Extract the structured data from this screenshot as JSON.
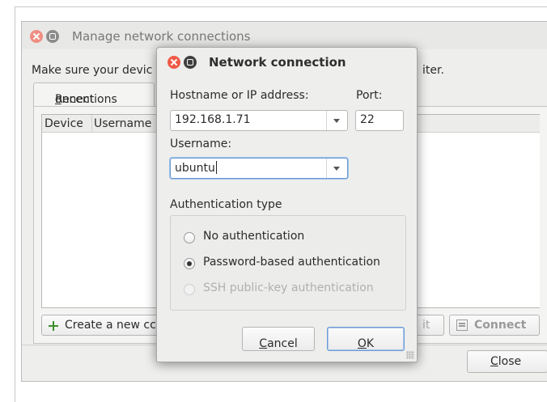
{
  "background_window": {
    "title": "Manage network connections",
    "instruction_start": "Make sure your devic",
    "instruction_end": "iter.",
    "tab": {
      "prefix": "Recent ",
      "accel": "c",
      "suffix": "onnections"
    },
    "columns": [
      "Device",
      "Username"
    ],
    "buttons": {
      "create": "Create a new cc",
      "edit": "it",
      "connect": "Connect",
      "close_accel": "C",
      "close_rest": "lose"
    }
  },
  "dialog": {
    "title": "Network connection",
    "hostname_label": "Hostname or IP address:",
    "hostname_value": "192.168.1.71",
    "port_label": "Port:",
    "port_value": "22",
    "username_label": "Username:",
    "username_value": "ubuntu",
    "auth_label": "Authentication type",
    "auth_options": [
      {
        "label": "No authentication",
        "checked": false,
        "disabled": false
      },
      {
        "label": "Password-based authentication",
        "checked": true,
        "disabled": false
      },
      {
        "label": "SSH public-key authentication",
        "checked": false,
        "disabled": true
      }
    ],
    "cancel": {
      "accel": "C",
      "rest": "ancel"
    },
    "ok": {
      "accel": "O",
      "rest": "K"
    }
  },
  "icons": [
    "close-icon",
    "maximize-icon",
    "chevron-down-icon",
    "plus-icon",
    "connect-icon",
    "resize-grip-icon"
  ]
}
